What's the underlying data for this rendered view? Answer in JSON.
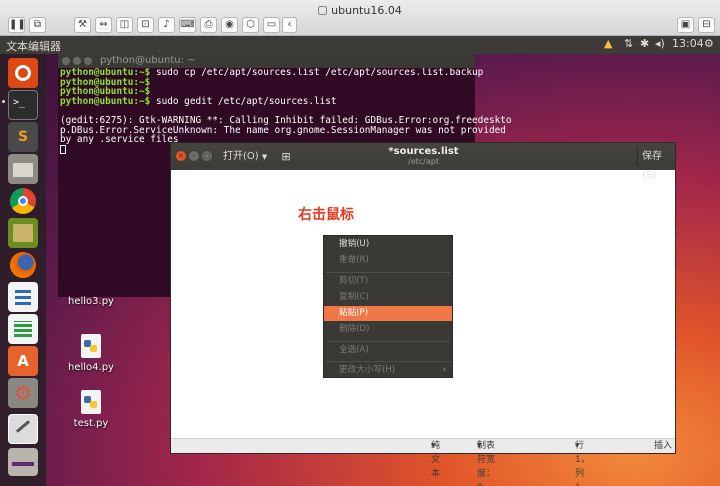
{
  "vm": {
    "title": "ubuntu16.04",
    "toolbar": [
      "❚❚",
      "⧉",
      "🔧",
      "⇔",
      "◫",
      "⊡",
      "🔈",
      "⌨",
      "🖨",
      "⎙",
      "⬡",
      "▭",
      "◂"
    ],
    "toolbar_right": [
      "▣",
      "⊟"
    ]
  },
  "panel": {
    "app_title": "文本编辑器",
    "indicators": [
      "⛭",
      "⇅",
      "✱",
      "🔊"
    ],
    "clock": "13:04",
    "gear": "⚙"
  },
  "launcher": {
    "items": [
      "ubuntu-dash",
      "terminal",
      "sublime-text",
      "files",
      "chrome",
      "books",
      "firefox",
      "libreoffice-writer",
      "libreoffice-calc",
      "software-center",
      "system-settings",
      "gedit",
      "disk"
    ]
  },
  "terminal": {
    "title": "python@ubuntu: ~",
    "lines": [
      {
        "prompt": "python@ubuntu:~$",
        "cmd": " sudo cp /etc/apt/sources.list /etc/apt/sources.list.backup"
      },
      {
        "prompt": "python@ubuntu:~$",
        "cmd": ""
      },
      {
        "prompt": "python@ubuntu:~$",
        "cmd": ""
      },
      {
        "prompt": "python@ubuntu:~$",
        "cmd": " sudo gedit /etc/apt/sources.list"
      }
    ],
    "output": "(gedit:6275): Gtk-WARNING **: Calling Inhibit failed: GDBus.Error:org.freedeskto\np.DBus.Error.ServiceUnknown: The name org.gnome.SessionManager was not provided\nby any .service files"
  },
  "desktop_files": [
    "hello3.py",
    "hello4.py",
    "test.py"
  ],
  "gedit": {
    "open_label": "打开(O)",
    "title": "*sources.list",
    "subtitle": "/etc/apt",
    "save_label": "保存(S)",
    "status": {
      "syntax": "纯文本",
      "tab_width": "制表符宽度：8",
      "position": "行 1，列 1",
      "mode": "插入"
    }
  },
  "annotation": "右击鼠标",
  "context_menu": {
    "items": [
      {
        "label": "撤销(U)",
        "state": "normal"
      },
      {
        "label": "重做(R)",
        "state": "disabled"
      },
      {
        "label": "剪切(T)",
        "state": "disabled"
      },
      {
        "label": "复制(C)",
        "state": "disabled"
      },
      {
        "label": "粘贴(P)",
        "state": "highlighted"
      },
      {
        "label": "删除(D)",
        "state": "disabled"
      },
      {
        "label": "全选(A)",
        "state": "disabled"
      },
      {
        "label": "更改大小写(H)",
        "state": "disabled"
      }
    ]
  },
  "colors": {
    "accent": "#f07746",
    "annotation": "#e53a1e",
    "terminal_bg": "#300a24",
    "prompt": "#8ae234"
  }
}
